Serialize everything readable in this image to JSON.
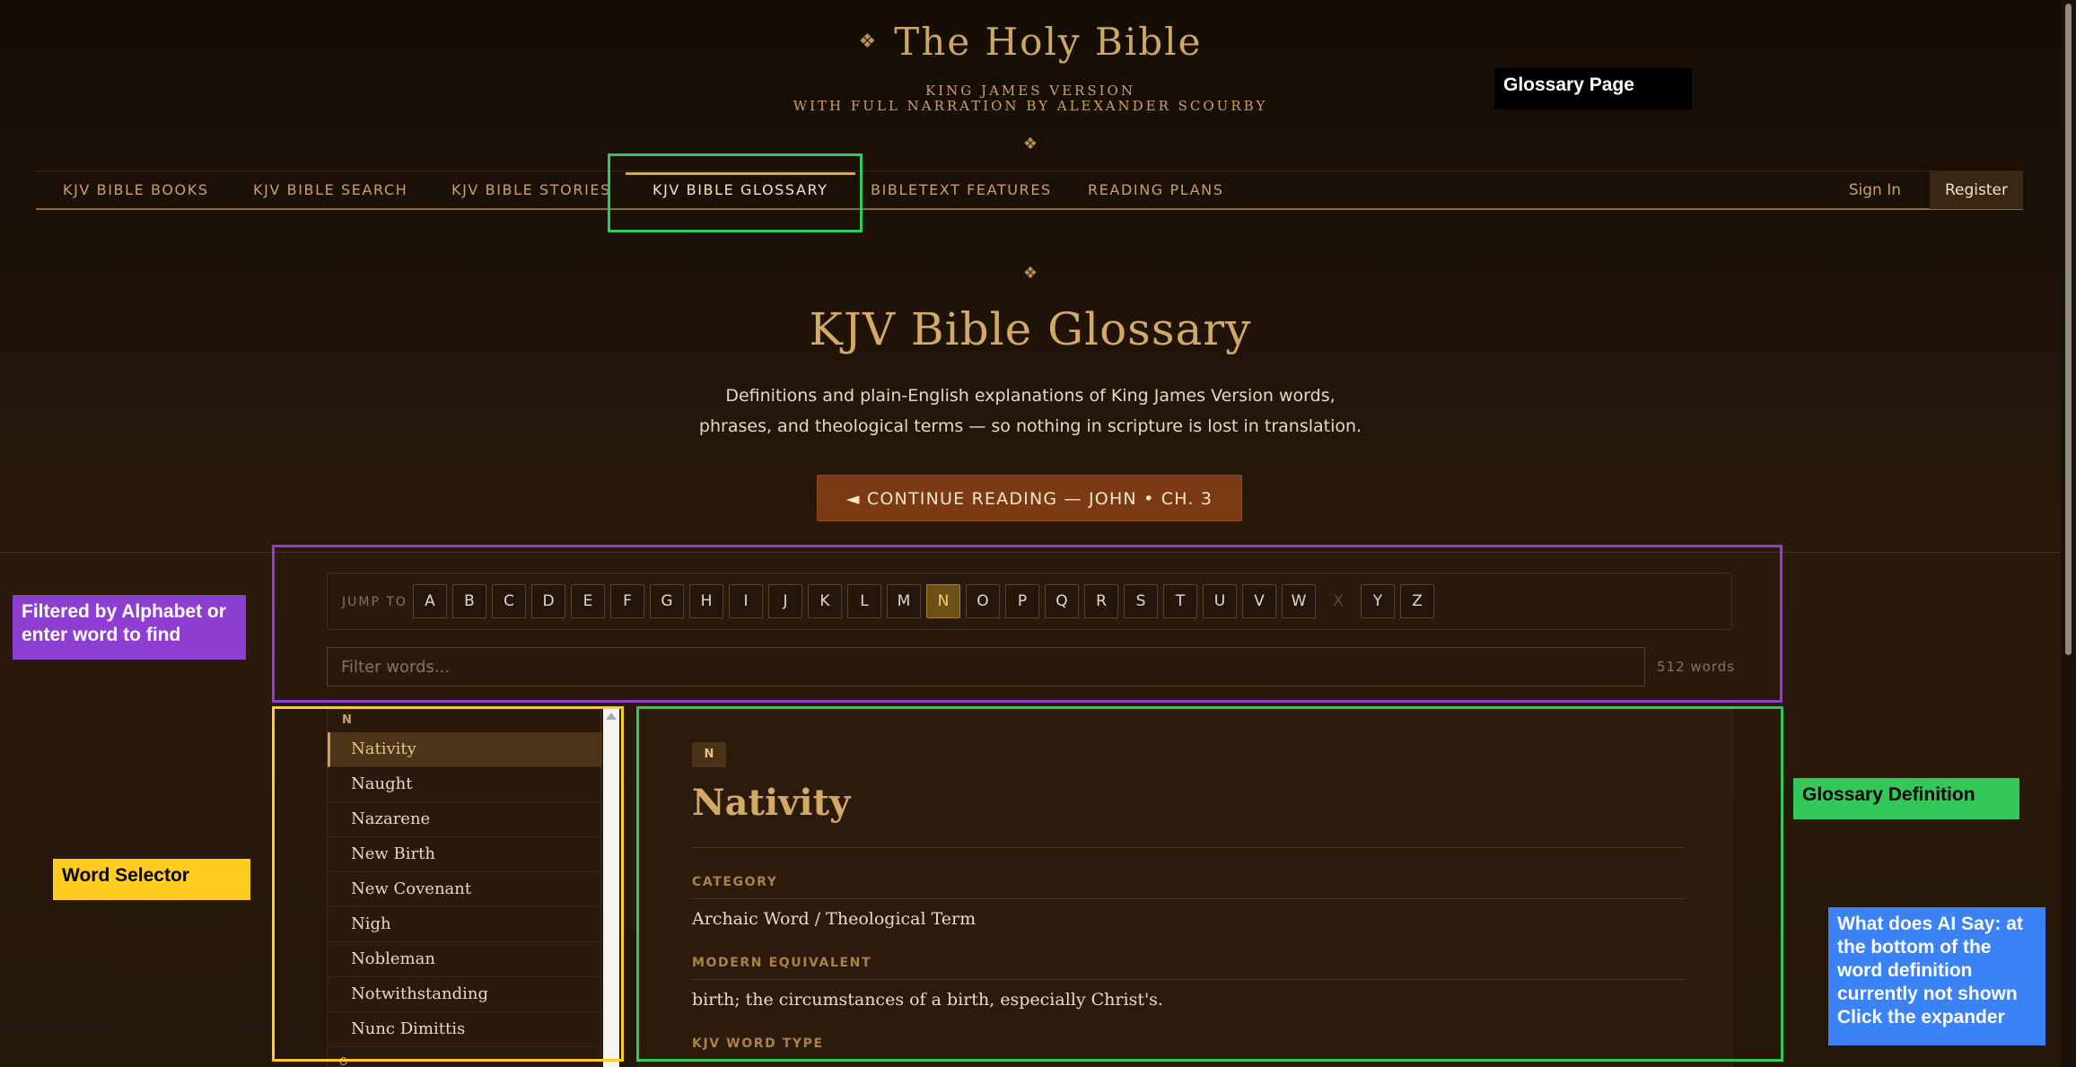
{
  "site": {
    "title": "The Holy Bible",
    "subtitle_line1": "KING JAMES VERSION",
    "subtitle_line2": "WITH FULL NARRATION BY ALEXANDER SCOURBY",
    "ornament": "❖"
  },
  "nav": {
    "items": [
      {
        "label": "KJV BIBLE BOOKS"
      },
      {
        "label": "KJV BIBLE SEARCH"
      },
      {
        "label": "KJV BIBLE STORIES"
      },
      {
        "label": "KJV BIBLE GLOSSARY",
        "active": true
      },
      {
        "label": "BIBLETEXT FEATURES"
      },
      {
        "label": "READING PLANS"
      }
    ],
    "sign_in": "Sign In",
    "register": "Register"
  },
  "hero": {
    "title": "KJV Bible Glossary",
    "desc_line1": "Definitions and plain-English explanations of King James Version words,",
    "desc_line2": "phrases, and theological terms — so nothing in scripture is lost in translation.",
    "continue_button": "◄ CONTINUE READING — JOHN • CH. 3"
  },
  "alphabet": {
    "jump_label": "JUMP TO",
    "letters": [
      "A",
      "B",
      "C",
      "D",
      "E",
      "F",
      "G",
      "H",
      "I",
      "J",
      "K",
      "L",
      "M",
      "N",
      "O",
      "P",
      "Q",
      "R",
      "S",
      "T",
      "U",
      "V",
      "W",
      "X",
      "Y",
      "Z"
    ],
    "active": "N",
    "disabled": [
      "X"
    ]
  },
  "filter": {
    "placeholder": "Filter words...",
    "value": "",
    "count": "512 words"
  },
  "word_list": {
    "group_label": "N",
    "items": [
      "Nativity",
      "Naught",
      "Nazarene",
      "New Birth",
      "New Covenant",
      "Nigh",
      "Nobleman",
      "Notwithstanding",
      "Nunc Dimittis"
    ],
    "active": "Nativity",
    "next_group_label": "O"
  },
  "definition": {
    "badge": "N",
    "word": "Nativity",
    "category_label": "CATEGORY",
    "category": "Archaic Word / Theological Term",
    "modern_label": "MODERN EQUIVALENT",
    "modern": "birth; the circumstances of a birth, especially Christ's.",
    "word_type_label": "KJV WORD TYPE"
  },
  "annotations": {
    "glossary_page": "Glossary Page",
    "filtered": "Filtered by Alphabet or enter word to find",
    "word_selector": "Word Selector",
    "glossary_definition": "Glossary Definition",
    "ai_note": "What does AI Say: at the bottom of the word definition currently not shown Click the expander",
    "colors": {
      "green": "#34c759",
      "purple": "#8e3fd1",
      "yellow": "#ffcc1f",
      "blue": "#3b82f6",
      "black": "#000000"
    }
  }
}
